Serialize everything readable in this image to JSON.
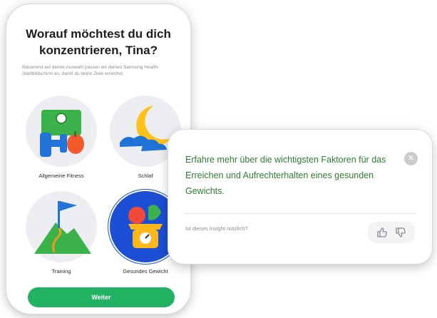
{
  "onboarding": {
    "title": "Worauf möchtest du dich konzentrieren, Tina?",
    "subtitle": "Basierend auf deiner Auswahl passen wir deinen Samsung Health-Startbildschirm an, damit du deine Ziele erreichst.",
    "options": [
      {
        "label": "Allgemeine Fitness",
        "icon": "dumbbell-scale-icon",
        "selected": false
      },
      {
        "label": "Schlaf",
        "icon": "moon-cloud-icon",
        "selected": false
      },
      {
        "label": "Training",
        "icon": "mountain-flag-icon",
        "selected": false
      },
      {
        "label": "Gesundes Gewicht",
        "icon": "scale-fruit-icon",
        "selected": true
      }
    ],
    "continue_label": "Weiter"
  },
  "insight": {
    "headline": "Erfahre mehr über die wichtigsten Faktoren für das Erreichen und Aufrechterhalten eines gesunden Gewichts.",
    "question": "Ist dieses Insight nützlich?",
    "close_icon": "close-icon",
    "thumbs_up_icon": "thumbs-up-icon",
    "thumbs_down_icon": "thumbs-down-icon"
  },
  "colors": {
    "accent_green": "#22b264",
    "headline_green": "#2e7d32",
    "selected_blue": "#1d4fd4"
  }
}
